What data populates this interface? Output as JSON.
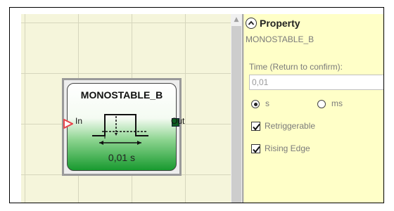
{
  "block": {
    "title": "MONOSTABLE_B",
    "input_label": "In",
    "output_label": "Out",
    "time_display": "0,01 s"
  },
  "property_panel": {
    "title": "Property",
    "element_name": "MONOSTABLE_B",
    "time_label": "Time (Return to confirm):",
    "time_value": "0,01",
    "unit_options": [
      {
        "label": "s",
        "selected": true
      },
      {
        "label": "ms",
        "selected": false
      }
    ],
    "retriggerable": {
      "label": "Retriggerable",
      "checked": true
    },
    "rising_edge": {
      "label": "Rising Edge",
      "checked": true
    }
  },
  "colors": {
    "canvas_bg": "#f5f5db",
    "panel_bg": "#ffffc8",
    "block_green": "#189a2f",
    "input_port": "#e8454a",
    "output_port": "#0d5e22"
  },
  "icons": {
    "collapse": "chevron-up-circle-icon",
    "scroll_up": "scroll-up-arrow-icon",
    "pulse": "pulse-waveform-icon",
    "check": "check-icon"
  }
}
